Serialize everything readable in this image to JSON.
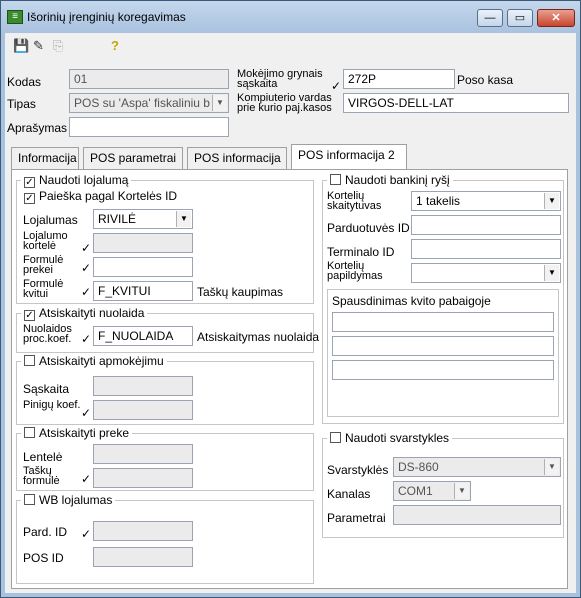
{
  "window": {
    "title": "Išorinių įrenginių koregavimas",
    "min_glyph": "—",
    "max_glyph": "▭",
    "close_glyph": "✕"
  },
  "toolbar": {
    "save_icon": "💾",
    "edit_icon": "✎",
    "copy_icon": "⎘",
    "help_icon": "?"
  },
  "header": {
    "kodas_label": "Kodas",
    "kodas_value": "01",
    "tipas_label": "Tipas",
    "tipas_value": "POS su 'Aspa' fiskaliniu b",
    "aprasymas_label": "Aprašymas",
    "aprasymas_value": "",
    "mokejimo_label": "Mokėjimo grynais sąskaita",
    "mokejimo_value": "272P",
    "mokejimo_desc": "Poso kasa",
    "kompiuterio_label": "Kompiuterio vardas prie kurio paj.kasos",
    "kompiuterio_value": "VIRGOS-DELL-LAT"
  },
  "tabs": [
    "Informacija",
    "POS parametrai",
    "POS informacija",
    "POS informacija 2"
  ],
  "left": {
    "lojalumas_group": {
      "title": "Naudoti lojalumą",
      "checked": true,
      "paieska_label": "Paieška pagal Kortelės ID",
      "paieska_checked": true,
      "lojalumas_label": "Lojalumas",
      "lojalumas_value": "RIVILĖ",
      "kortele_label": "Lojalumo kortelė",
      "kortele_value": "",
      "prekei_label": "Formulė prekei",
      "prekei_value": "",
      "kvitui_label": "Formulė kvitui",
      "kvitui_value": "F_KVITUI",
      "kvitui_desc": "Taškų kaupimas"
    },
    "nuolaida_group": {
      "title": "Atsiskaityti nuolaida",
      "checked": true,
      "koef_label": "Nuolaidos proc.koef.",
      "koef_value": "F_NUOLAIDA",
      "koef_desc": "Atsiskaitymas nuolaida"
    },
    "apmokejimu_group": {
      "title": "Atsiskaityti apmokėjimu",
      "checked": false,
      "saskaita_label": "Sąskaita",
      "saskaita_value": "",
      "pinigu_label": "Pinigų koef.",
      "pinigu_value": ""
    },
    "preke_group": {
      "title": "Atsiskaityti preke",
      "checked": false,
      "lentele_label": "Lentelė",
      "lentele_value": "",
      "tasku_label": "Taškų formulė",
      "tasku_value": ""
    },
    "wb_group": {
      "title": "WB lojalumas",
      "checked": false,
      "pard_label": "Pard. ID",
      "pard_value": "",
      "pos_label": "POS ID",
      "pos_value": ""
    }
  },
  "right": {
    "bank_group": {
      "title": "Naudoti bankinį ryšį",
      "checked": false,
      "skaitytuvas_label": "Kortelių skaitytuvas",
      "skaitytuvas_value": "1 takelis",
      "parduotuves_label": "Parduotuvės ID",
      "parduotuves_value": "",
      "terminalo_label": "Terminalo ID",
      "terminalo_value": "",
      "papildymas_label": "Kortelių papildymas",
      "papildymas_value": "",
      "spausdinimas_title": "Spausdinimas kvito pabaigoje",
      "spausdinimas_lines": [
        "",
        "",
        ""
      ]
    },
    "scale_group": {
      "title": "Naudoti svarstykles",
      "checked": false,
      "svarstykles_label": "Svarstyklės",
      "svarstykles_value": "DS-860",
      "kanalas_label": "Kanalas",
      "kanalas_value": "COM1",
      "parametrai_label": "Parametrai",
      "parametrai_value": ""
    }
  },
  "glyphs": {
    "check": "✓",
    "dropdown": "▼"
  }
}
